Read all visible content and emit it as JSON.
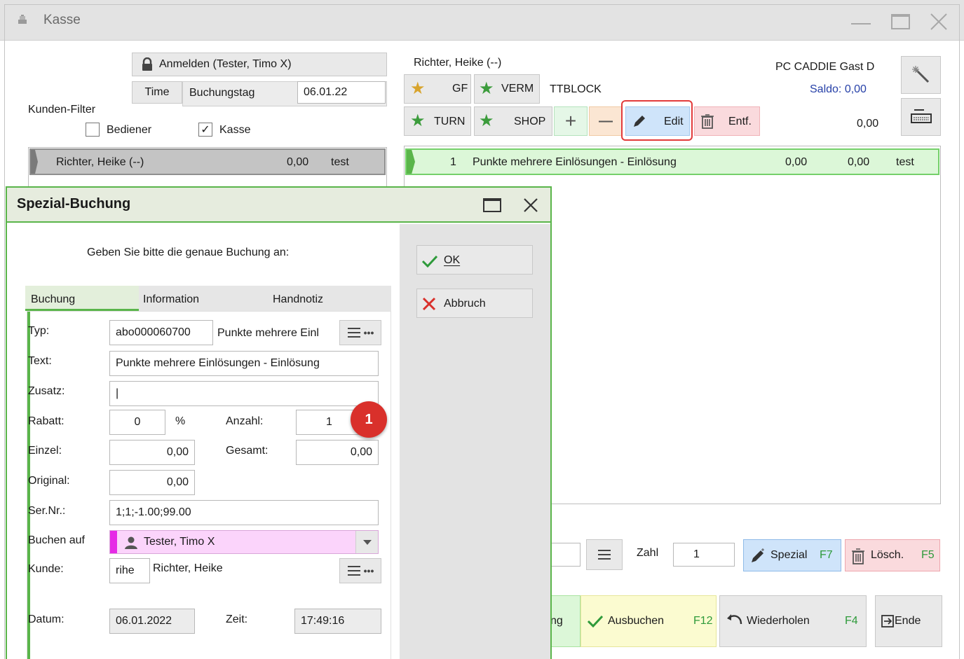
{
  "window": {
    "title": "Kasse"
  },
  "left_panel": {
    "login_label": "Anmelden (Tester, Timo X)",
    "time_label": "Time",
    "booking_day_label": "Buchungstag",
    "booking_day_value": "06.01.22",
    "customer_filter_label": "Kunden-Filter",
    "filter_operator_label": "Bediener",
    "filter_register_label": "Kasse",
    "filter_register_checked": "✓",
    "customer_row": {
      "name": "Richter, Heike (--)",
      "amount": "0,00",
      "note": "test"
    }
  },
  "right_panel": {
    "customer_name": "Richter, Heike (--)",
    "pc_caddie_label": "PC CADDIE Gast D",
    "saldo_label": "Saldo: 0,00",
    "total_value": "0,00",
    "quick_buttons": {
      "gf": "GF",
      "verm": "VERM",
      "ttblock": "TTBLOCK",
      "turn": "TURN",
      "shop": "SHOP",
      "plus": "+",
      "minus": "—",
      "edit": "Edit",
      "remove": "Entf."
    },
    "position_row": {
      "number": "1",
      "text": "Punkte mehrere Einlösungen - Einlösung",
      "price": "0,00",
      "total": "0,00",
      "note": "test"
    },
    "zahl_label": "Zahl",
    "zahl_value": "1",
    "spezial_label": "Spezial",
    "spezial_key": "F7",
    "loesch_label": "Lösch.",
    "loesch_key": "F5",
    "buchung_partial": "ng",
    "ausbuchen_label": "Ausbuchen",
    "ausbuchen_key": "F12",
    "wiederholen_label": "Wiederholen",
    "wiederholen_key": "F4",
    "ende_label": "Ende"
  },
  "dialog": {
    "title": "Spezial-Buchung",
    "prompt": "Geben Sie bitte die genaue Buchung an:",
    "tabs": [
      "Buchung",
      "Information",
      "Handnotiz"
    ],
    "ok_label": "OK",
    "cancel_label": "Abbruch",
    "fields": {
      "typ_label": "Typ:",
      "typ_code": "abo000060700",
      "typ_name": "Punkte mehrere Einl",
      "text_label": "Text:",
      "text_value": "Punkte mehrere Einlösungen - Einlösung",
      "zusatz_label": "Zusatz:",
      "zusatz_value": "|",
      "rabatt_label": "Rabatt:",
      "rabatt_value": "0",
      "rabatt_unit": "%",
      "anzahl_label": "Anzahl:",
      "anzahl_value": "1",
      "einzel_label": "Einzel:",
      "einzel_value": "0,00",
      "gesamt_label": "Gesamt:",
      "gesamt_value": "0,00",
      "original_label": "Original:",
      "original_value": "0,00",
      "sernr_label": "Ser.Nr.:",
      "sernr_value": "1;1;-1.00;99.00",
      "buchen_auf_label": "Buchen auf",
      "buchen_auf_value": "Tester, Timo X",
      "kunde_label": "Kunde:",
      "kunde_code": "rihe",
      "kunde_name": "Richter, Heike",
      "datum_label": "Datum:",
      "datum_value": "06.01.2022",
      "zeit_label": "Zeit:",
      "zeit_value": "17:49:16"
    },
    "marker": "1"
  },
  "colors": {
    "accent_green": "#5ab54a",
    "edit_highlight": "#e23b3b",
    "marker_red": "#d9302b"
  }
}
